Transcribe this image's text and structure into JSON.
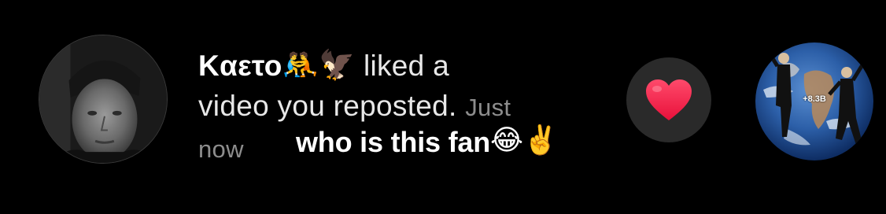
{
  "notification": {
    "username": "Kαετο",
    "username_emojis": [
      "🤼",
      "🦅"
    ],
    "action_line_1": "liked a",
    "action_line_2": "video you reposted.",
    "timestamp_1": "Just",
    "timestamp_2": "now"
  },
  "caption": {
    "text": "who is this fan",
    "emojis": [
      "😂",
      "✌️"
    ]
  },
  "video": {
    "view_count": "+8.3B"
  },
  "colors": {
    "background": "#000000",
    "heart": "#ff2d55",
    "like_button_bg": "#2a2a2a",
    "secondary_text": "#8d8d8d"
  },
  "icons": {
    "like": "heart-icon"
  }
}
